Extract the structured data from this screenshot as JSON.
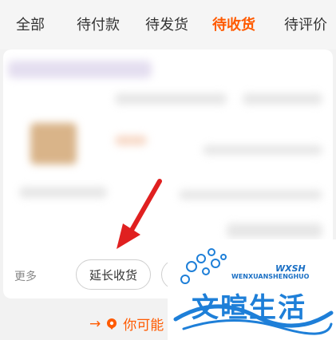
{
  "tabs": [
    {
      "label": "全部"
    },
    {
      "label": "待付款"
    },
    {
      "label": "待发货"
    },
    {
      "label": "待收货",
      "active": true
    },
    {
      "label": "待评价"
    }
  ],
  "order_card": {
    "more_label": "更多",
    "extend_button_label": "延长收货"
  },
  "bottom_hint": {
    "arrow": "→",
    "text": "你可能"
  },
  "watermark": {
    "title": "文暄生活",
    "subtitle": "WENXUANSHENGHUO",
    "mark": "WXSH"
  },
  "colors": {
    "accent": "#ff5a00",
    "annotation_arrow": "#e02020",
    "watermark_blue": "#1e7fd8"
  }
}
